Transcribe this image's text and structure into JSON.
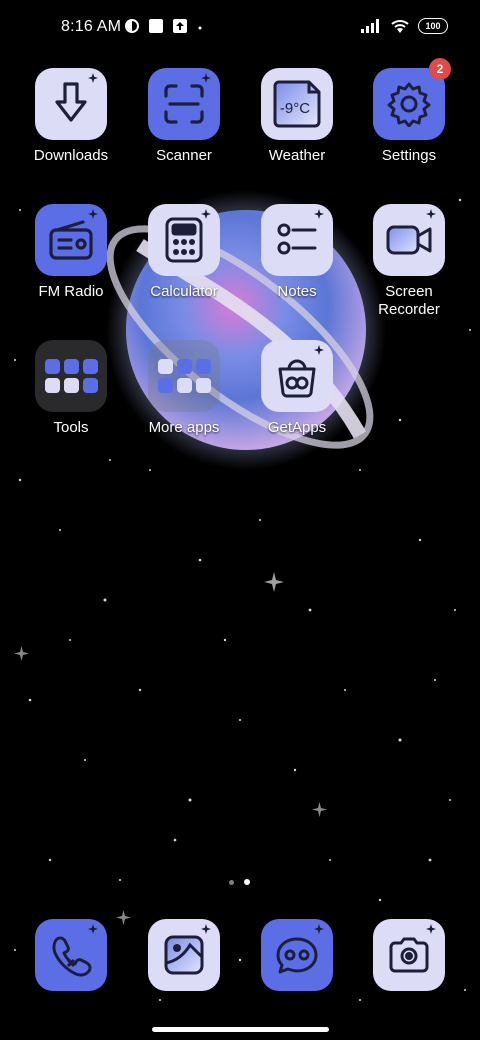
{
  "status_bar": {
    "time": "8:16 AM",
    "battery": "100"
  },
  "apps": [
    {
      "id": "downloads",
      "label": "Downloads",
      "style": "light",
      "icon": "download-icon"
    },
    {
      "id": "scanner",
      "label": "Scanner",
      "style": "blue",
      "icon": "scanner-icon"
    },
    {
      "id": "weather",
      "label": "Weather",
      "style": "light",
      "icon": "weather-icon",
      "icon_text": "-9°C"
    },
    {
      "id": "settings",
      "label": "Settings",
      "style": "blue",
      "icon": "gear-icon",
      "badge": "2"
    },
    {
      "id": "fm-radio",
      "label": "FM Radio",
      "style": "blue",
      "icon": "radio-icon"
    },
    {
      "id": "calculator",
      "label": "Calculator",
      "style": "light",
      "icon": "calculator-icon"
    },
    {
      "id": "notes",
      "label": "Notes",
      "style": "light",
      "icon": "notes-icon"
    },
    {
      "id": "screen-recorder",
      "label": "Screen\nRecorder",
      "style": "light",
      "icon": "video-camera-icon"
    },
    {
      "id": "tools",
      "label": "Tools",
      "style": "folder",
      "icon": "folder-icon"
    },
    {
      "id": "more-apps",
      "label": "More apps",
      "style": "folder",
      "icon": "folder-icon"
    },
    {
      "id": "getapps",
      "label": "GetApps",
      "style": "light",
      "icon": "shopping-bag-icon"
    }
  ],
  "dock": [
    {
      "id": "phone",
      "style": "blue",
      "icon": "phone-icon"
    },
    {
      "id": "gallery",
      "style": "light",
      "icon": "gallery-icon"
    },
    {
      "id": "messages",
      "style": "blue",
      "icon": "message-icon"
    },
    {
      "id": "camera",
      "style": "light",
      "icon": "camera-icon"
    }
  ],
  "page_indicator": {
    "pages": 2,
    "active": 2
  },
  "colors": {
    "tile_light": "#dcdcf6",
    "tile_blue": "#5c6ee6",
    "badge": "#e24949"
  }
}
